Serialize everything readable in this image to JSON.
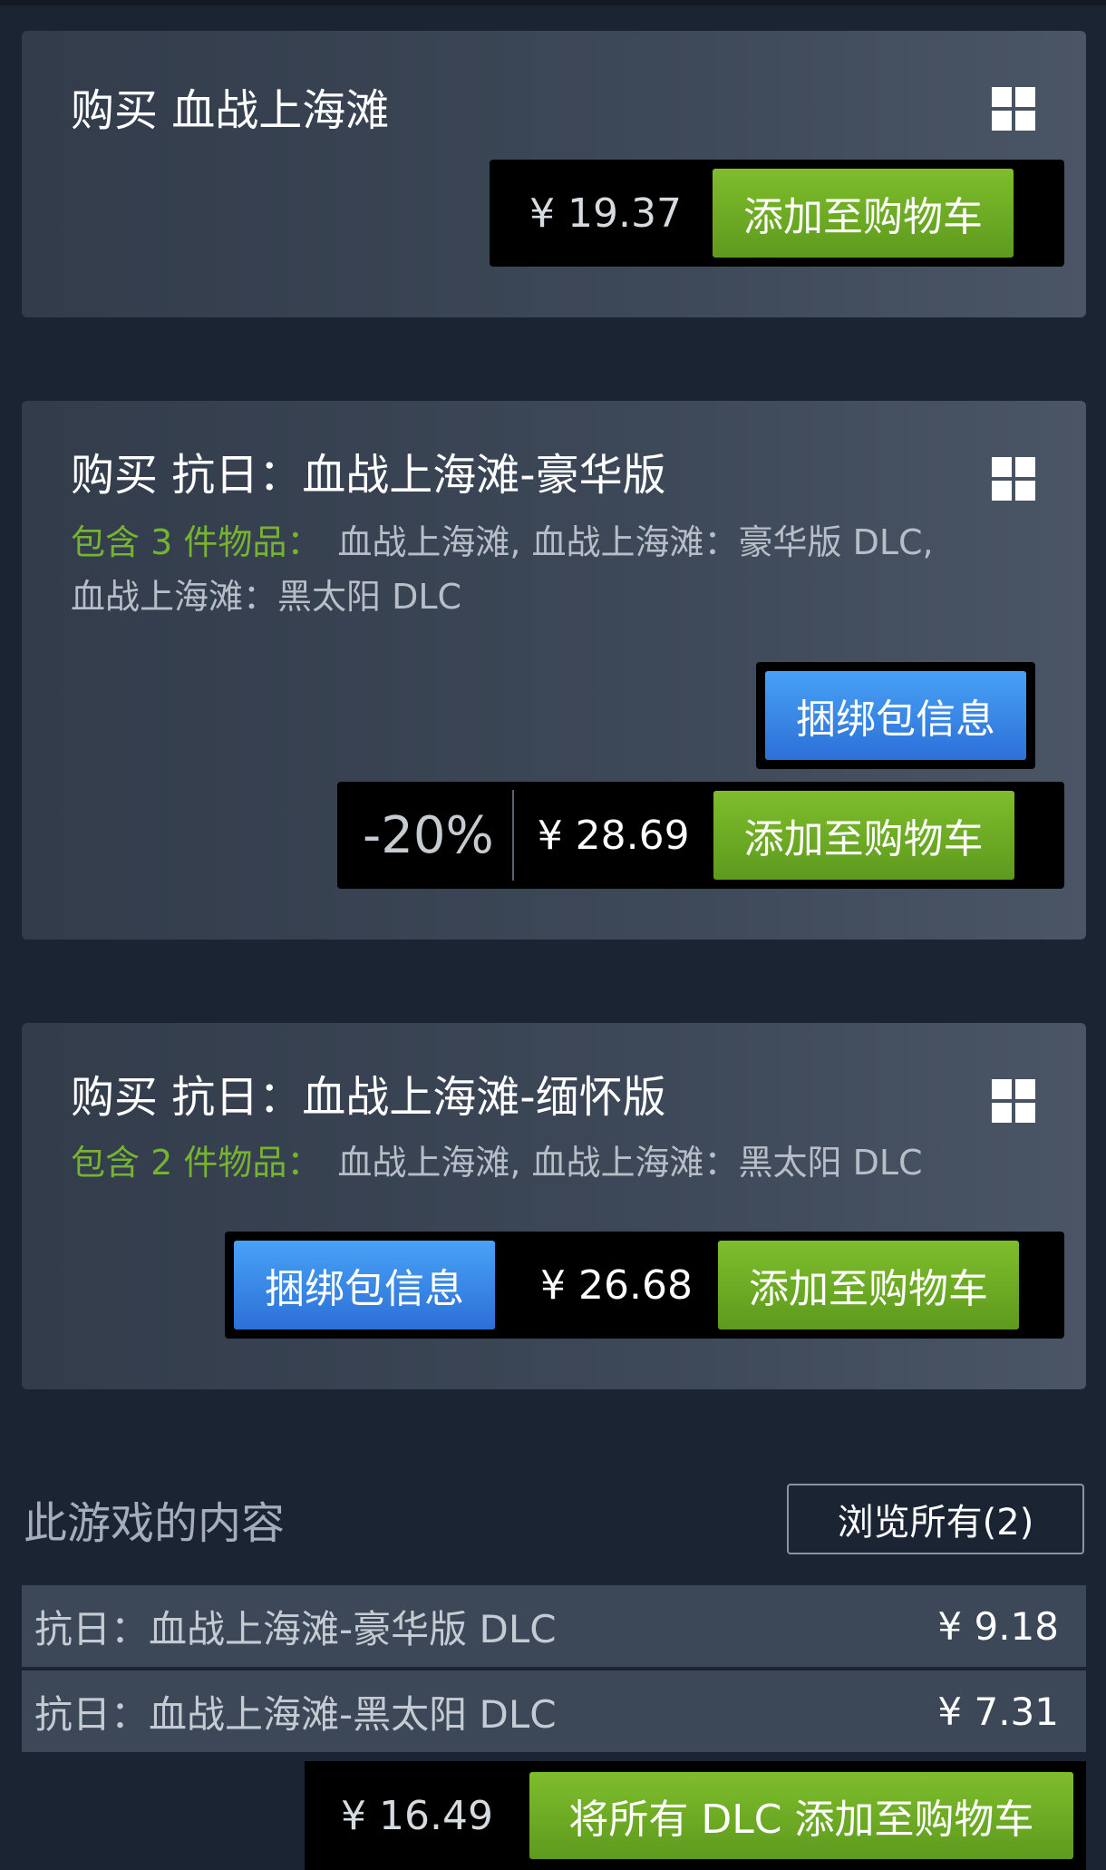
{
  "purchase_options": [
    {
      "title": "购买 血战上海滩",
      "price": "¥ 19.37",
      "cart_label": "添加至购物车",
      "platform_icon": "windows-icon"
    },
    {
      "title": "购买 抗日：血战上海滩-豪华版",
      "includes_label": "包含 3 件物品：",
      "includes_items_line1": "血战上海滩, 血战上海滩：豪华版 DLC,",
      "includes_items_line2": "血战上海滩：黑太阳 DLC",
      "bundle_info_label": "捆绑包信息",
      "discount": "-20%",
      "price": "¥ 28.69",
      "cart_label": "添加至购物车",
      "platform_icon": "windows-icon"
    },
    {
      "title": "购买 抗日：血战上海滩-缅怀版",
      "includes_label": "包含 2 件物品：",
      "includes_items": "血战上海滩, 血战上海滩：黑太阳 DLC",
      "bundle_info_label": "捆绑包信息",
      "price": "¥ 26.68",
      "cart_label": "添加至购物车",
      "platform_icon": "windows-icon"
    }
  ],
  "dlc_section": {
    "title": "此游戏的内容",
    "browse_all_label": "浏览所有(2)",
    "items": [
      {
        "name": "抗日：血战上海滩-豪华版 DLC",
        "price": "¥ 9.18"
      },
      {
        "name": "抗日：血战上海滩-黑太阳 DLC",
        "price": "¥ 7.31"
      }
    ],
    "total_price": "¥ 16.49",
    "add_all_label": "将所有 DLC 添加至购物车"
  },
  "colors": {
    "background": "#1b2433",
    "cart_green": "#6ba924",
    "bundle_blue": "#3b8ae8",
    "includes_green": "#76b332"
  }
}
